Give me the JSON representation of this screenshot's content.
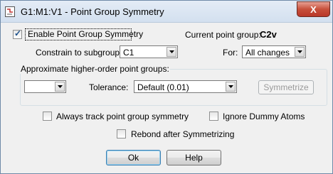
{
  "window": {
    "title": "G1:M1:V1 - Point Group Symmetry",
    "close_glyph": "X"
  },
  "enable": {
    "label": "Enable Point Group Symmetry",
    "checked": true
  },
  "current_point_group": {
    "label": "Current point group:",
    "value": "C2v"
  },
  "constrain": {
    "label": "Constrain to subgroup:",
    "value": "C1"
  },
  "for": {
    "label": "For:",
    "value": "All changes"
  },
  "approx_group": {
    "title": "Approximate higher-order point groups:",
    "group_value": "",
    "tolerance_label": "Tolerance:",
    "tolerance_value": "Default (0.01)",
    "symmetrize_label": "Symmetrize"
  },
  "options": {
    "always_track": {
      "label": "Always track point group symmetry",
      "checked": false
    },
    "ignore_dummy": {
      "label": "Ignore Dummy Atoms",
      "checked": false
    },
    "rebond": {
      "label": "Rebond after Symmetrizing",
      "checked": false
    }
  },
  "buttons": {
    "ok": "Ok",
    "help": "Help"
  },
  "colors": {
    "title_bar": "#d3e0ef",
    "close": "#c7503b",
    "dialog_bg": "#f0f0f0"
  }
}
